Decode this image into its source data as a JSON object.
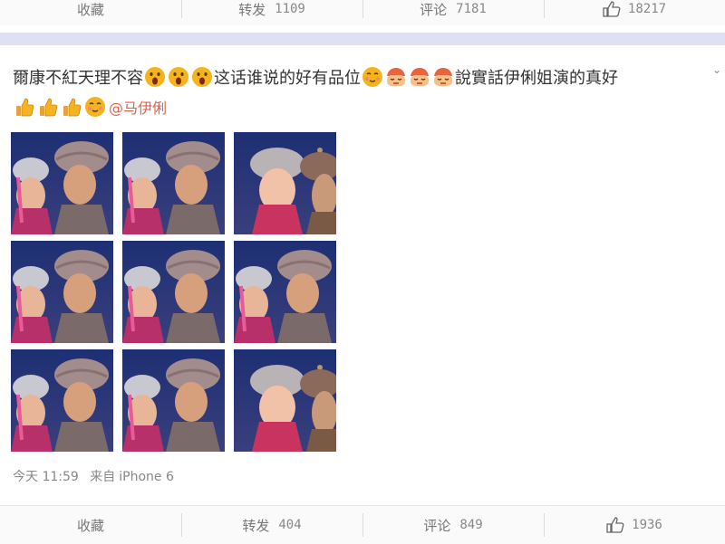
{
  "top_bar": {
    "collect": {
      "label": "收藏"
    },
    "repost": {
      "label": "转发",
      "count": "1109"
    },
    "comment": {
      "label": "评论",
      "count": "7181"
    },
    "like": {
      "count": "18217"
    }
  },
  "post": {
    "text_part1": "爾康不紅天理不容",
    "text_part2": "这话谁说的好有品位",
    "text_part3": "說實話伊俐姐演的真好",
    "mention": "@马伊俐",
    "emojis_line1_a": [
      "shocked-face-icon",
      "shocked-face-icon",
      "shocked-face-icon"
    ],
    "emojis_line1_b": [
      "shy-face-icon",
      "bow-face-icon",
      "bow-face-icon",
      "bow-face-icon"
    ],
    "emojis_line2": [
      "thumbs-up-icon",
      "thumbs-up-icon",
      "thumbs-up-icon",
      "shy-face-icon"
    ],
    "images": [
      {
        "name": "photo-1"
      },
      {
        "name": "photo-2"
      },
      {
        "name": "photo-3"
      },
      {
        "name": "photo-4"
      },
      {
        "name": "photo-5"
      },
      {
        "name": "photo-6"
      },
      {
        "name": "photo-7"
      },
      {
        "name": "photo-8"
      },
      {
        "name": "photo-9"
      }
    ],
    "time": "今天 11:59",
    "source_prefix": "来自",
    "source": "iPhone 6"
  },
  "bottom_bar": {
    "collect": {
      "label": "收藏"
    },
    "repost": {
      "label": "转发",
      "count": "404"
    },
    "comment": {
      "label": "评论",
      "count": "849"
    },
    "like": {
      "count": "1936"
    }
  },
  "colors": {
    "band": "#dfe1f2",
    "mention": "#e0624b",
    "emoji": "#f5b41e"
  }
}
